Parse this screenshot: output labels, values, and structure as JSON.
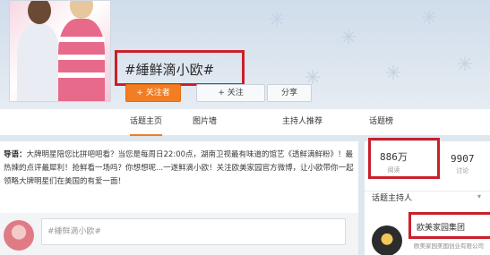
{
  "header": {
    "page_title": "#綞鲜滴小欧#",
    "buttons": {
      "follow_main": "+ 关注者",
      "follow": "+ 关注",
      "share": "分享"
    }
  },
  "tabs": [
    {
      "label": "话题主页",
      "active": true
    },
    {
      "label": "图片墙",
      "active": false
    },
    {
      "label": "主持人推荐",
      "active": false
    },
    {
      "label": "话题榜",
      "active": false
    }
  ],
  "feed": {
    "notice_lead": "导语：",
    "notice_text": "大牌明星陪您比拼吧吧看？当您是每周日22:00点，湖南卫视最有味道的馆艺《透鲜满鲜粉》！最热辣的点评最犀利！抢鲜看一场吗？你想想呢...一遂鲜滴小欧！关注欧美家园官方微博，让小欧带你一起领略大牌明星们在美国的有爱一面！",
    "composer_placeholder": "#綞鲜滴小欧#"
  },
  "stats": {
    "reads": {
      "value": "886万",
      "label": "阅读"
    },
    "discussions": {
      "value": "9907",
      "label": "讨论"
    }
  },
  "host": {
    "section_title": "话题主持人",
    "name": "欧美家园集团",
    "subtitle": "欧美家园美国创业有限公司"
  },
  "colors": {
    "accent": "#f27d22",
    "highlight_box": "#c9202a",
    "link": "#2a6fb5"
  }
}
